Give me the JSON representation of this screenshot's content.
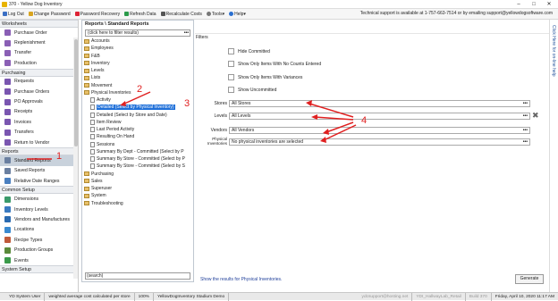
{
  "window": {
    "title": "370 - Yellow Dog Inventory"
  },
  "toolbar": {
    "items": [
      "Log Out",
      "Change Password",
      "Password Recovery",
      "Refresh Data",
      "Recalculate Costs",
      "Tools",
      "Help"
    ],
    "support": "Technical support is available at 1-757-663-7514 or by emailing support@yellowdogsoftware.com"
  },
  "sidebar": {
    "worksheets_title": "Worksheets",
    "worksheets": [
      "Purchase Order",
      "Replenishment",
      "Transfer",
      "Production"
    ],
    "purchasing_title": "Purchasing",
    "purchasing": [
      "Requests",
      "Purchase Orders",
      "PO Approvals",
      "Receipts",
      "Invoices",
      "Transfers",
      "Return to Vendor"
    ],
    "reports_title": "Reports",
    "reports": [
      "Standard Reports",
      "Saved Reports",
      "Relative Date Ranges"
    ],
    "setup_title": "Common Setup",
    "setup": [
      "Dimensions",
      "Inventory Levels",
      "Vendors and Manufactures",
      "Locations",
      "Recipe Types",
      "Production Groups",
      "Events"
    ],
    "system_title": "System Setup"
  },
  "tree": {
    "header": "Reports \\ Standard Reports",
    "filter_placeholder": "(click here to filter results)",
    "nodes": [
      "Accounts",
      "Employees",
      "F&B",
      "Inventory",
      "Levels",
      "Lists",
      "Movement",
      "Physical Inventories",
      "Activity",
      "Detailed (Select by Physical Inventory)",
      "Detailed (Select by Store and Date)",
      "Item Review",
      "Last Period Activity",
      "Resulting On Hand",
      "Sessions",
      "Summary By Dept - Committed (Select by P",
      "Summary By Store - Committed (Select by P",
      "Summary By Store - Committed (Select by S",
      "Purchasing",
      "Sales",
      "Superuser",
      "System",
      "Troubleshooting"
    ],
    "search_value": "(search)"
  },
  "filters": {
    "title": "Filters",
    "checks": [
      "Hide Committed",
      "Show Only Items With No Counts Entered",
      "Show Only Items With Variances",
      "Show Uncommitted"
    ],
    "stores_label": "Stores",
    "stores_value": "All Stores",
    "levels_label": "Levels",
    "levels_value": "All Levels",
    "vendors_label": "Vendors",
    "vendors_value": "All Vendors",
    "pi_label": "Physical Inventories",
    "pi_value": "No physical inventories are selected",
    "show_text": "Show the results for Physical Inventories.",
    "generate": "Generate"
  },
  "annotations": [
    "1",
    "2",
    "3",
    "4"
  ],
  "status": {
    "user": "YD System User",
    "cost": "weighted average cost calculated per store",
    "zoom": "100%",
    "stadium": "YellowDogInventory Stadium Demo",
    "host": "ydcsupport@hosting.net",
    "db": "YDI_HallwayLab_Retail",
    "build": "Build 370",
    "date": "Friday, April 10, 2020 11:17 AM"
  },
  "right_strip": "Click Here for on-line help",
  "colors": {
    "selection": "#1e6fd9",
    "annotation": "#e02020",
    "link": "#1f3f9a"
  }
}
